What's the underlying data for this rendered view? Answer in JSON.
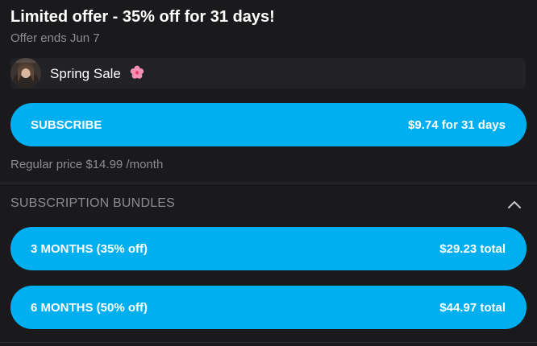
{
  "offer": {
    "title": "Limited offer - 35% off for 31 days!",
    "ends": "Offer ends Jun 7"
  },
  "promo": {
    "label": "Spring Sale",
    "icon": "cherry-blossom-icon"
  },
  "subscribe": {
    "label": "SUBSCRIBE",
    "price": "$9.74 for 31 days"
  },
  "regular_price": "Regular price $14.99 /month",
  "bundles": {
    "header": "SUBSCRIPTION BUNDLES",
    "toggle_icon": "chevron-up-icon",
    "items": [
      {
        "label": "3 MONTHS (35% off)",
        "price": "$29.23 total"
      },
      {
        "label": "6 MONTHS (50% off)",
        "price": "$44.97 total"
      }
    ]
  },
  "colors": {
    "background": "#1a191c",
    "accent": "#00aff0",
    "muted_text": "#8a8d93",
    "card": "#222125"
  }
}
